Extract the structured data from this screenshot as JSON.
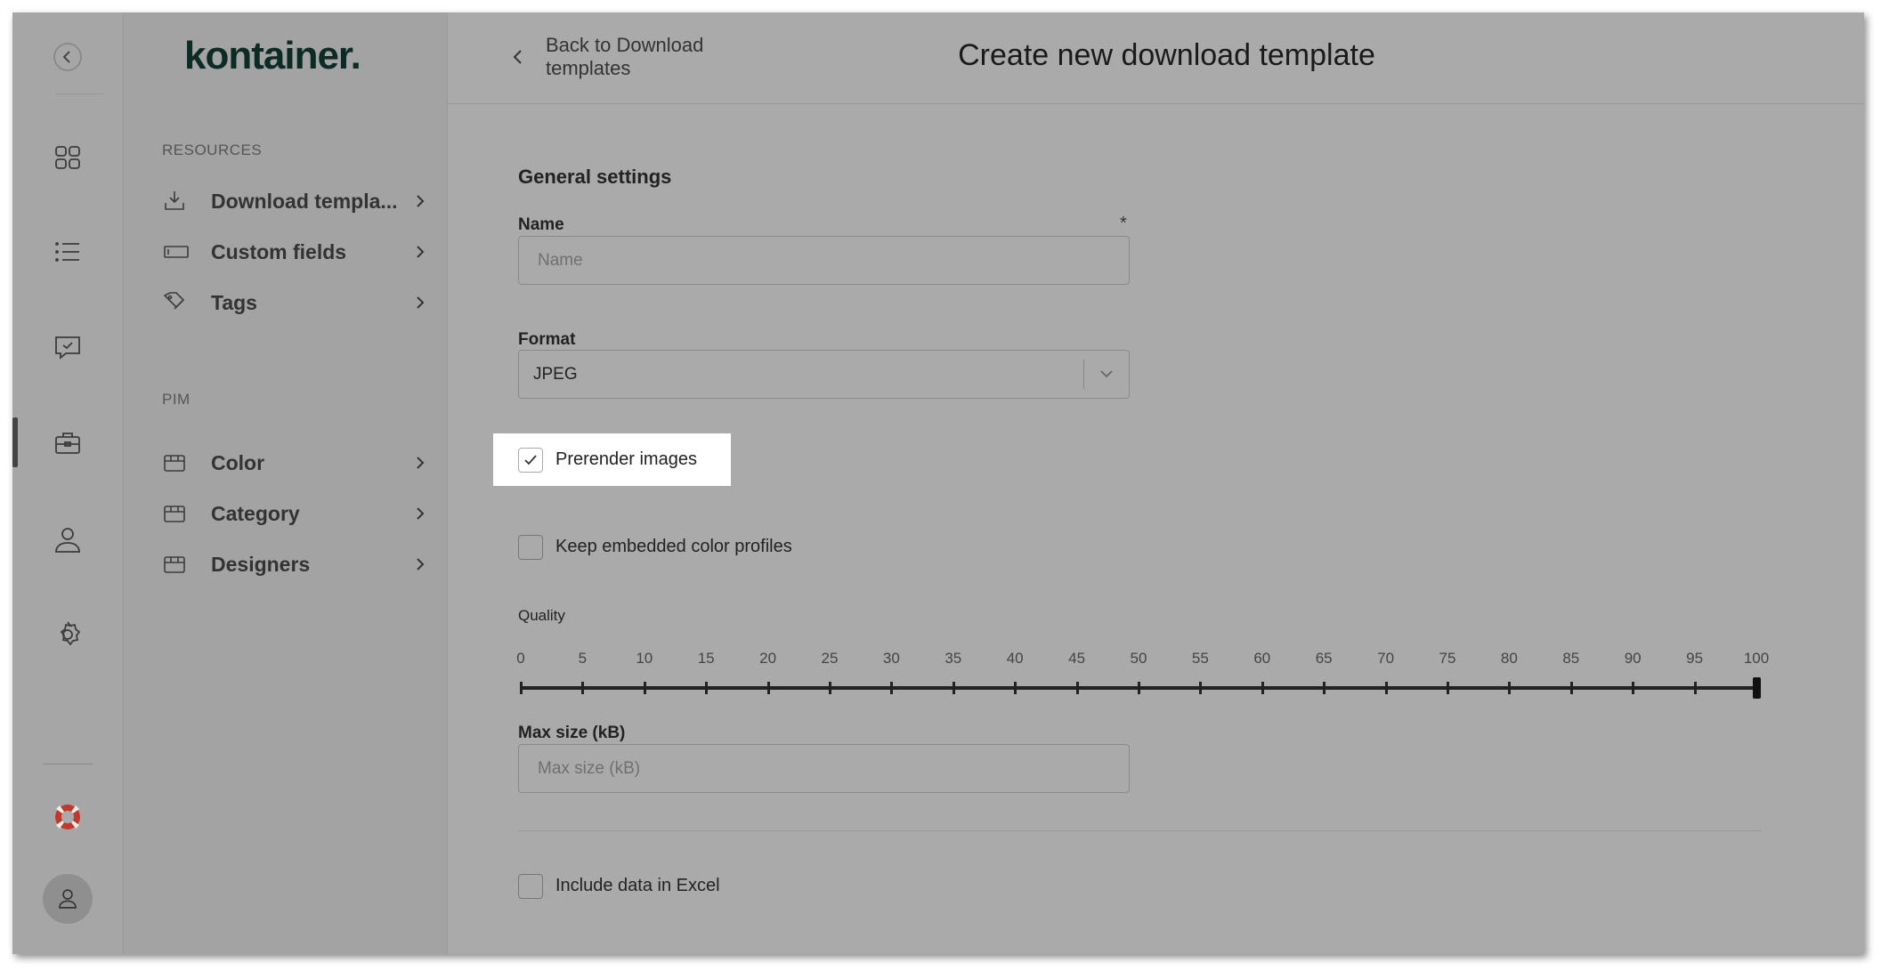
{
  "brand": {
    "logo": "kontainer."
  },
  "rail": {
    "items": [
      "collapse",
      "dashboard",
      "list",
      "feedback",
      "briefcase",
      "user",
      "settings",
      "help",
      "account"
    ],
    "active": "briefcase"
  },
  "panel": {
    "sections": [
      {
        "title": "RESOURCES",
        "items": [
          {
            "label": "Download templa...",
            "icon": "download-icon"
          },
          {
            "label": "Custom fields",
            "icon": "field-icon"
          },
          {
            "label": "Tags",
            "icon": "tag-icon"
          }
        ]
      },
      {
        "title": "PIM",
        "items": [
          {
            "label": "Color",
            "icon": "box-icon"
          },
          {
            "label": "Category",
            "icon": "box-icon"
          },
          {
            "label": "Designers",
            "icon": "box-icon"
          }
        ]
      }
    ]
  },
  "header": {
    "back_line1": "Back to Download",
    "back_line2": "templates",
    "title": "Create new download template"
  },
  "form": {
    "section_title": "General settings",
    "name_label": "Name",
    "name_required": "*",
    "name_placeholder": "Name",
    "format_label": "Format",
    "format_value": "JPEG",
    "prerender_label": "Prerender images",
    "prerender_checked": true,
    "keep_profiles_label": "Keep embedded color profiles",
    "keep_profiles_checked": false,
    "quality_label": "Quality",
    "quality_ticks": [
      "0",
      "5",
      "10",
      "15",
      "20",
      "25",
      "30",
      "35",
      "40",
      "45",
      "50",
      "55",
      "60",
      "65",
      "70",
      "75",
      "80",
      "85",
      "90",
      "95",
      "100"
    ],
    "quality_value": 100,
    "maxsize_label": "Max size (kB)",
    "maxsize_placeholder": "Max size (kB)",
    "excel_label": "Include data in Excel",
    "excel_checked": false
  },
  "colors": {
    "overlay": "#aaaaaa",
    "logo": "#0d2b25",
    "highlight": "#ffffff",
    "help": "#c0392b"
  }
}
